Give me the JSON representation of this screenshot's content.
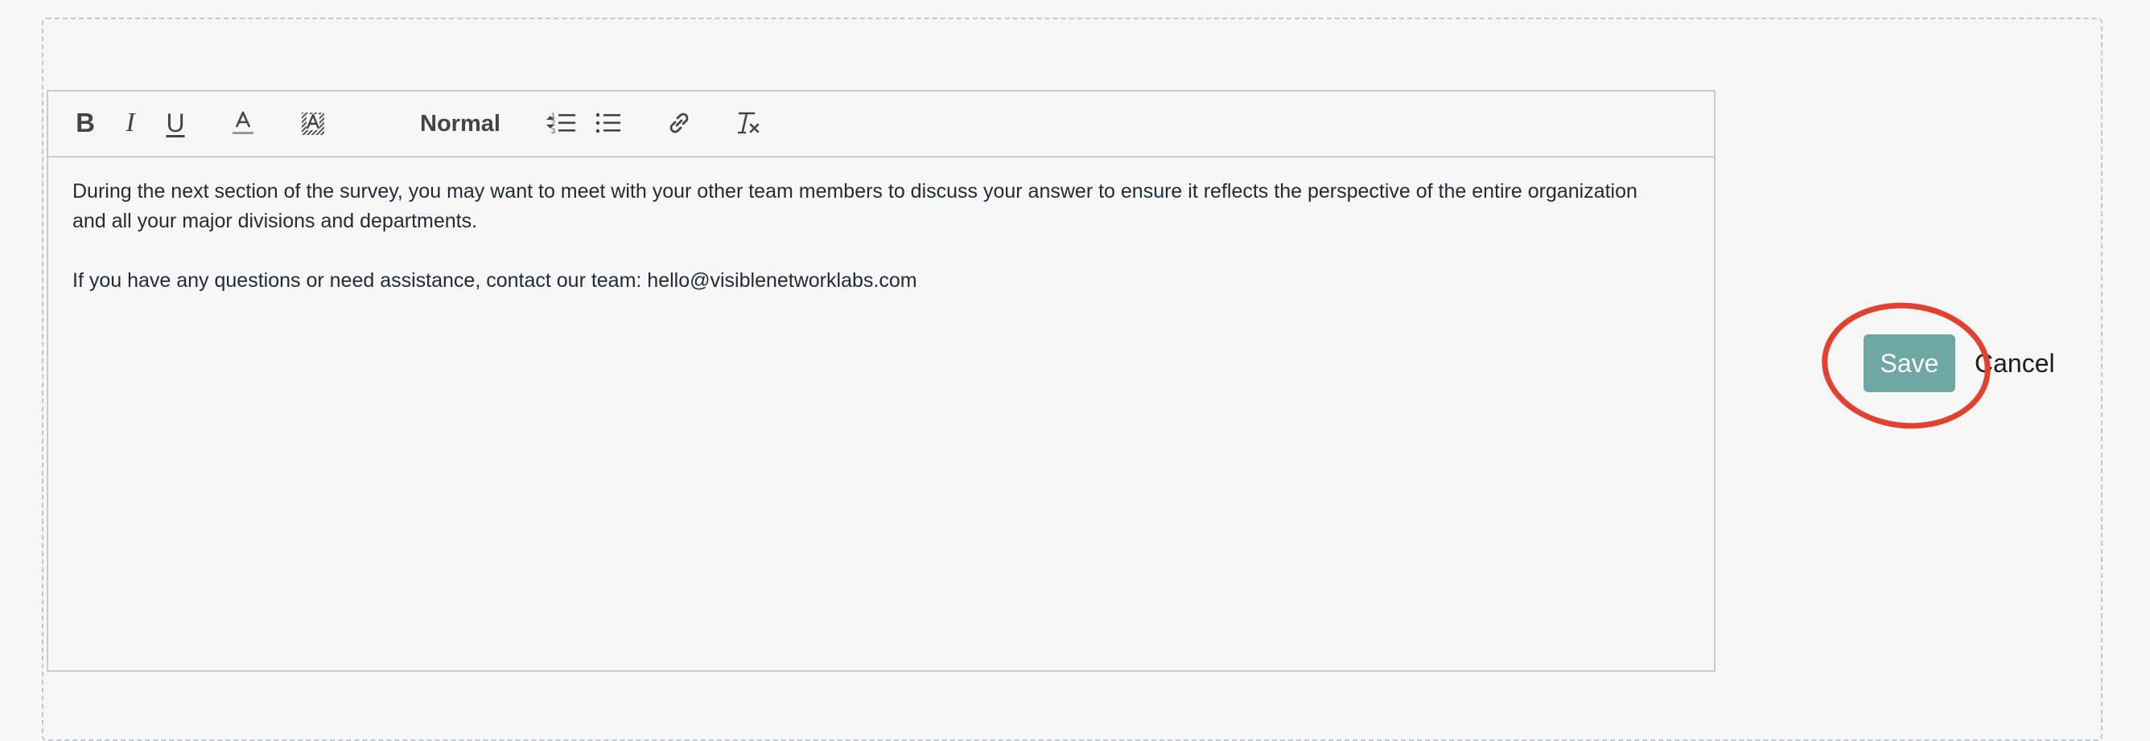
{
  "toolbar": {
    "bold_label": "B",
    "italic_label": "I",
    "underline_label": "U",
    "header_select_value": "Normal",
    "icons": {
      "text_color": "text-color-icon",
      "background_color": "background-color-icon",
      "ordered_list": "ordered-list-icon",
      "bullet_list": "bullet-list-icon",
      "link": "link-icon",
      "clear_format": "clear-format-icon",
      "select_arrows": "chevron-updown-icon"
    }
  },
  "editor": {
    "paragraph1": "During the next section of the survey, you may want to meet with your other team members to discuss your answer to ensure it reflects the perspective of the entire organization and all your major divisions and departments.",
    "paragraph2": "If you have any questions or need assistance, contact our team: hello@visiblenetworklabs.com"
  },
  "actions": {
    "save_label": "Save",
    "cancel_label": "Cancel"
  },
  "colors": {
    "save_button": "#6ea8a2",
    "highlight_ring": "#e2412f",
    "frame_border": "#c4c9d0"
  }
}
